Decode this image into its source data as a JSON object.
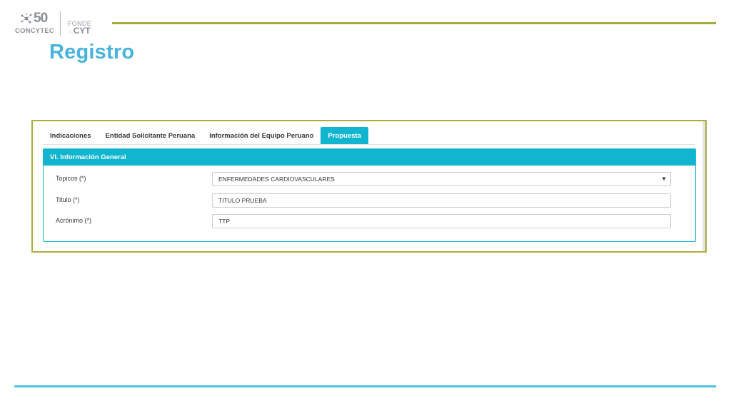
{
  "header": {
    "logo_concytec_number": "50",
    "logo_concytec_name": "CONCYTEC",
    "logo_fonde_line1": "FONDE",
    "logo_fonde_line2": "CYT",
    "title": "Registro"
  },
  "tabs": [
    {
      "label": "Indicaciones",
      "active": false
    },
    {
      "label": "Entidad Solicitante Peruana",
      "active": false
    },
    {
      "label": "Información del Equipo Peruano",
      "active": false
    },
    {
      "label": "Propuesta",
      "active": true
    }
  ],
  "panel": {
    "heading": "VI. Información General"
  },
  "form": {
    "topicos": {
      "label": "Topicos (*)",
      "value": "ENFERMEDADES CARDIOVASCULARES"
    },
    "titulo": {
      "label": "Titulo (*)",
      "value": "TITULO PRUEBA"
    },
    "acronimo": {
      "label": "Acrónimo (*)",
      "value": "TTP"
    }
  },
  "colors": {
    "title": "#48b3dc",
    "accent": "#12b5cf",
    "top_rule": "#a4ad3a",
    "frame_border": "#a9ae3c",
    "bottom_rule": "#4cc3e0"
  }
}
